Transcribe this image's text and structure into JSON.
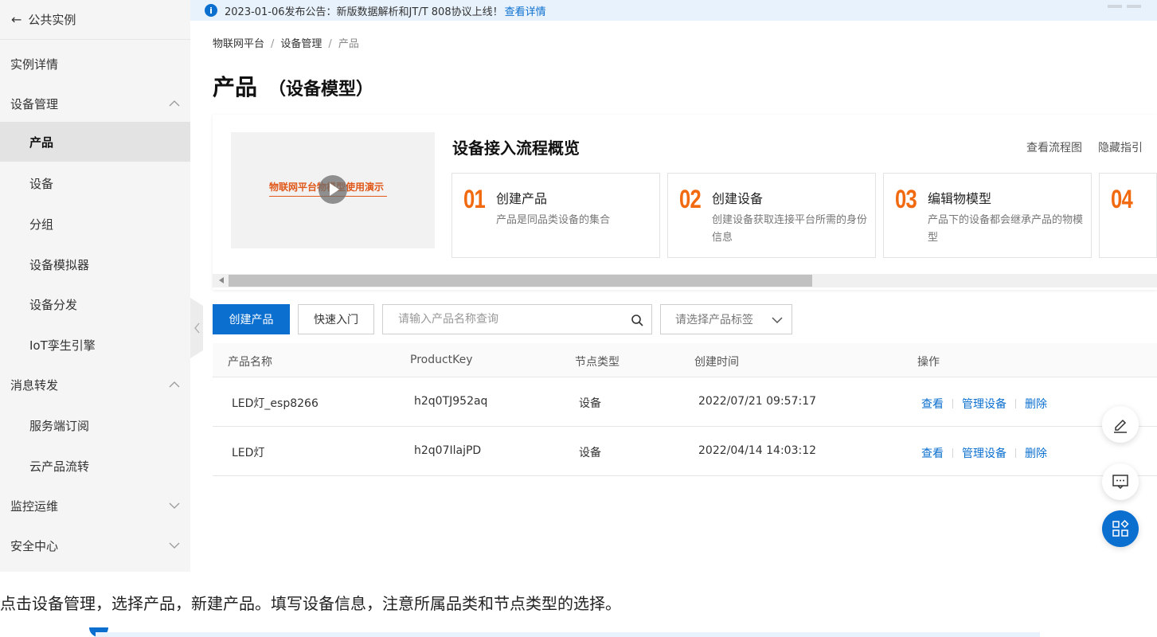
{
  "sidebar": {
    "back_label": "公共实例",
    "items": [
      {
        "label": "实例详情"
      },
      {
        "label": "设备管理"
      },
      {
        "label": "产品"
      },
      {
        "label": "设备"
      },
      {
        "label": "分组"
      },
      {
        "label": "设备模拟器"
      },
      {
        "label": "设备分发"
      },
      {
        "label": "IoT孪生引擎"
      },
      {
        "label": "消息转发"
      },
      {
        "label": "服务端订阅"
      },
      {
        "label": "云产品流转"
      },
      {
        "label": "监控运维"
      },
      {
        "label": "安全中心"
      }
    ]
  },
  "notice": {
    "text": "2023-01-06发布公告：新版数据解析和JT/T 808协议上线！",
    "link": "查看详情"
  },
  "breadcrumb": [
    "物联网平台",
    "设备管理",
    "产品"
  ],
  "page": {
    "title": "产品",
    "subtitle": "（设备模型）"
  },
  "guide": {
    "video_title": "物联网平台物模型使用演示",
    "title": "设备接入流程概览",
    "links": [
      "查看流程图",
      "隐藏指引"
    ],
    "steps": [
      {
        "num": "01",
        "title": "创建产品",
        "desc": "产品是同品类设备的集合"
      },
      {
        "num": "02",
        "title": "创建设备",
        "desc": "创建设备获取连接平台所需的身份信息"
      },
      {
        "num": "03",
        "title": "编辑物模型",
        "desc": "产品下的设备都会继承产品的物模型"
      },
      {
        "num": "04",
        "title": "",
        "desc": ""
      }
    ]
  },
  "toolbar": {
    "create_label": "创建产品",
    "quickstart_label": "快速入门",
    "search_placeholder": "请输入产品名称查询",
    "tag_placeholder": "请选择产品标签"
  },
  "table": {
    "columns": [
      "产品名称",
      "ProductKey",
      "节点类型",
      "创建时间",
      "操作"
    ],
    "rows": [
      {
        "name": "LED灯_esp8266",
        "key": "h2q0TJ952aq",
        "node": "设备",
        "created": "2022/07/21 09:57:17"
      },
      {
        "name": "LED灯",
        "key": "h2q07IlajPD",
        "node": "设备",
        "created": "2022/04/14 14:03:12"
      }
    ],
    "actions": [
      "查看",
      "管理设备",
      "删除"
    ]
  },
  "article": {
    "text": "点击设备管理，选择产品，新建产品。填写设备信息，注意所属品类和节点类型的选择。"
  },
  "colors": {
    "accent": "#0a6fcf",
    "step_number": "#f26a10"
  },
  "icons": [
    "arrow-left-icon",
    "chevron-up-icon",
    "chevron-down-icon",
    "info-icon",
    "play-icon",
    "search-icon",
    "edit-icon",
    "feedback-icon",
    "apps-icon"
  ]
}
